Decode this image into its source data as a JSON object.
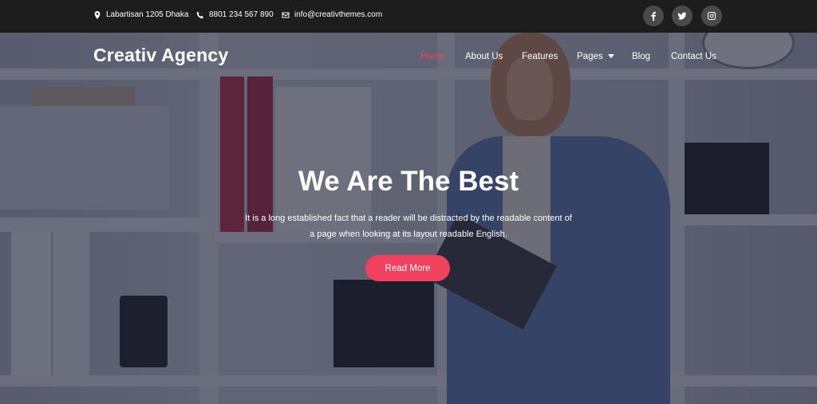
{
  "topbar": {
    "address": "Labartisan 1205 Dhaka",
    "phone": "8801 234 567 890",
    "email": "info@creativthemes.com",
    "social": [
      "facebook-icon",
      "twitter-icon",
      "instagram-icon"
    ]
  },
  "header": {
    "brand": "Creativ Agency",
    "nav": [
      "Home",
      "About Us",
      "Features",
      "Pages",
      "Blog",
      "Contact Us"
    ],
    "active_nav": "Home"
  },
  "hero": {
    "headline": "We Are The Best",
    "line1": "It is a long established fact that a reader will be distracted by the readable content of",
    "line2": "a page when looking at its layout readable English.",
    "button": "Read More"
  },
  "colors": {
    "accent": "#f0415e",
    "topbar": "#1d1d1d",
    "overlay": "#1c1f34"
  }
}
